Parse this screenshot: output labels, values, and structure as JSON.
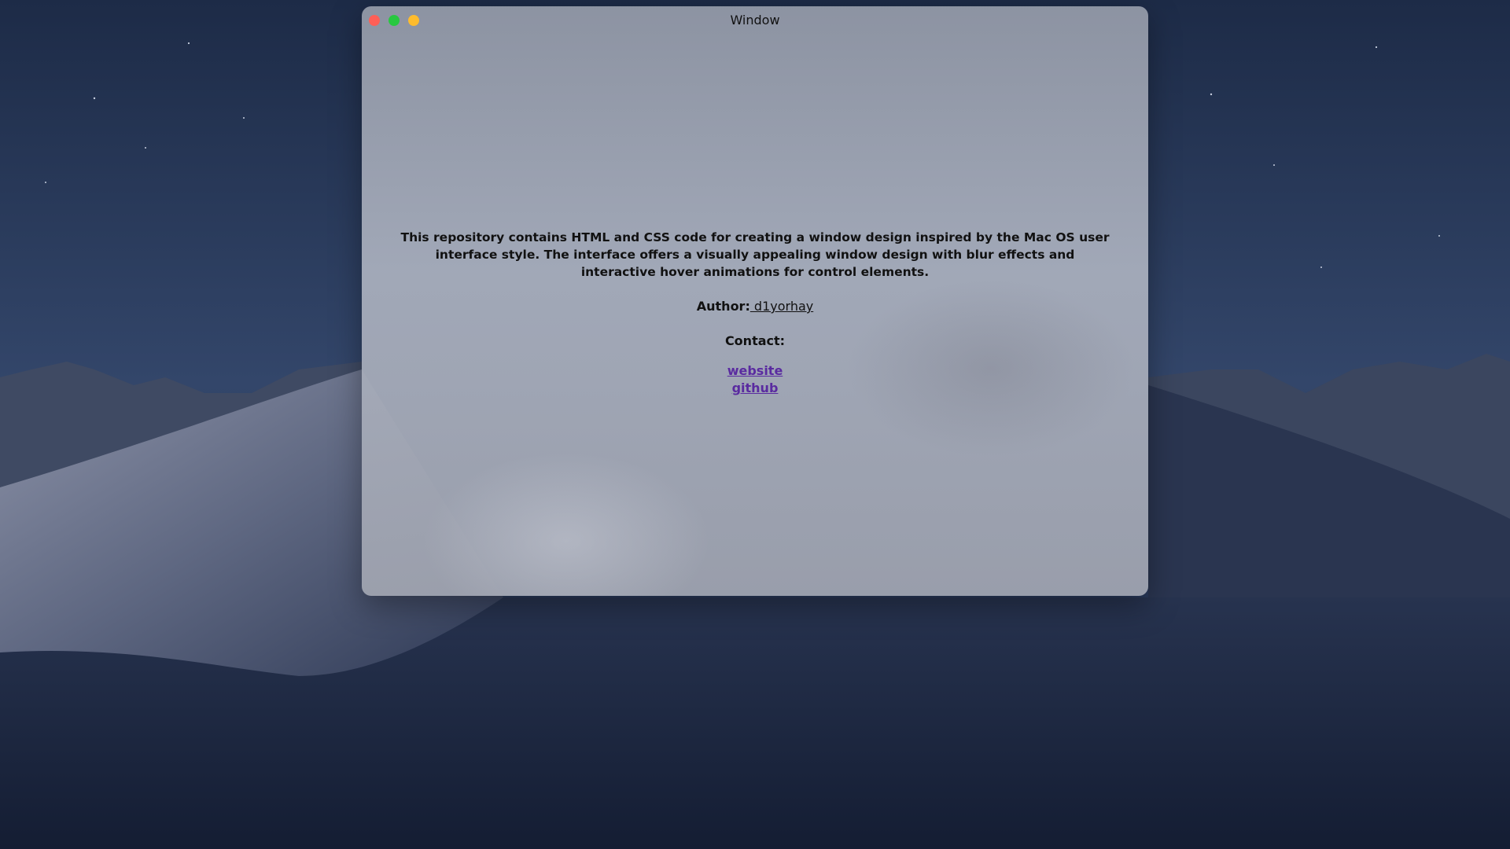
{
  "window": {
    "title": "Window"
  },
  "content": {
    "description": "This repository contains HTML and CSS code for creating a window design inspired by the Mac OS user interface style. The interface offers a visually appealing window design with blur effects and interactive hover animations for control elements.",
    "author_label": "Author:",
    "author_name": " d1yorhay",
    "contact_label": "Contact:",
    "links": {
      "website": "website",
      "github": "github"
    }
  },
  "colors": {
    "close_button": "#fe5f57",
    "maximize_button": "#28c840",
    "minimize_button": "#febc2e",
    "link": "#5a2ba0"
  }
}
